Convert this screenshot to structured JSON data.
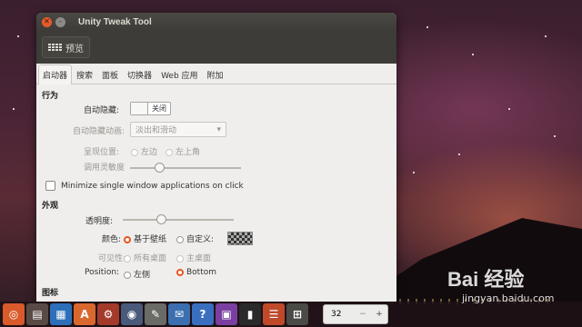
{
  "window": {
    "title": "Unity Tweak Tool",
    "close_icon": "close-icon",
    "minimize_icon": "minimize-icon"
  },
  "toolbar": {
    "overview_label": "预览"
  },
  "tabs": [
    "启动器",
    "搜索",
    "面板",
    "切换器",
    "Web 应用",
    "附加"
  ],
  "sections": {
    "behavior": "行为",
    "appearance": "外观",
    "icons": "图标"
  },
  "behavior": {
    "autohide_label": "自动隐藏:",
    "autohide_value": "关闭",
    "autohide_anim_label": "自动隐藏动画:",
    "autohide_anim_value": "淡出和滑动",
    "reveal_label": "呈现位置:",
    "reveal_left": "左边",
    "reveal_topleft": "左上角",
    "sensitivity_label": "调用灵敏度",
    "minimize_single": "Minimize single window applications on click"
  },
  "appearance": {
    "transparency_label": "透明度:",
    "color_label": "颜色:",
    "color_wallpaper": "基于壁纸",
    "color_custom": "自定义:",
    "visibility_label": "可见性:",
    "visibility_all": "所有桌面",
    "visibility_primary": "主桌面",
    "position_label": "Position:",
    "position_left": "左侧",
    "position_bottom": "Bottom"
  },
  "sliders": {
    "sensitivity": 0.25,
    "transparency": 0.34
  },
  "launcher": {
    "spin_value": "32",
    "minus": "−",
    "plus": "+"
  },
  "watermark": {
    "logo": "Bai 经验",
    "url": "jingyan.baidu.com"
  },
  "colors": {
    "accent": "#e95420",
    "launcher_bg": "#1e1216"
  }
}
